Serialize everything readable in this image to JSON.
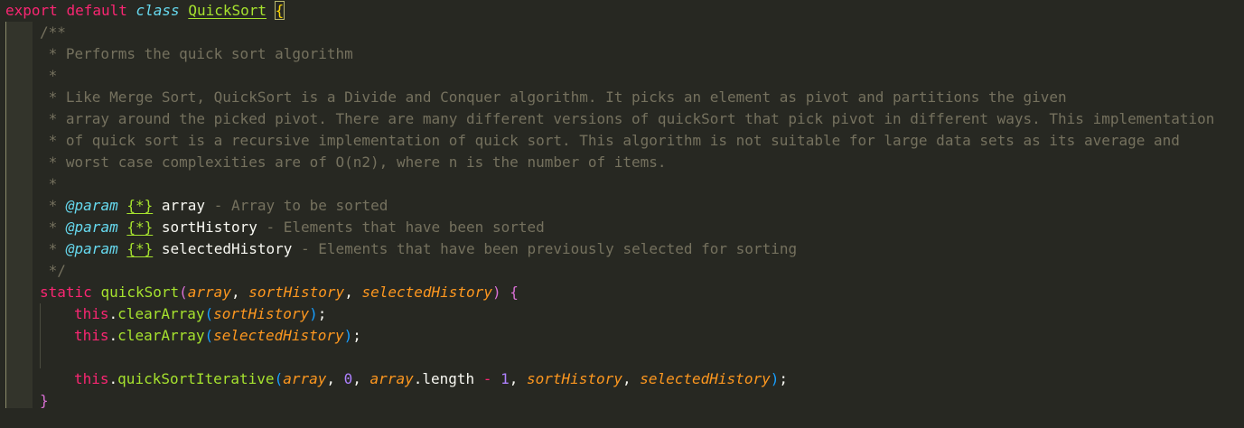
{
  "code": {
    "l1": {
      "export": "export",
      "default": "default",
      "class": "class",
      "name": "QuickSort",
      "brace": "{"
    },
    "l2": "/**",
    "l3": " * Performs the quick sort algorithm",
    "l4": " *",
    "l5": " * Like Merge Sort, QuickSort is a Divide and Conquer algorithm. It picks an element as pivot and partitions the given",
    "l6": " * array around the picked pivot. There are many different versions of quickSort that pick pivot in different ways. This implementation",
    "l7": " * of quick sort is a recursive implementation of quick sort. This algorithm is not suitable for large data sets as its average and",
    "l8": " * worst case complexities are of O(n2), where n is the number of items.",
    "l9": " *",
    "p1": {
      "star": " * ",
      "tag": "@param",
      "type": "{*}",
      "name": "array",
      "desc": " - Array to be sorted"
    },
    "p2": {
      "star": " * ",
      "tag": "@param",
      "type": "{*}",
      "name": "sortHistory",
      "desc": " - Elements that have been sorted"
    },
    "p3": {
      "star": " * ",
      "tag": "@param",
      "type": "{*}",
      "name": "selectedHistory",
      "desc": " - Elements that have been previously selected for sorting"
    },
    "l13": " */",
    "l14": {
      "static": "static",
      "fn": "quickSort",
      "open": "(",
      "a": "array",
      "c1": ", ",
      "b": "sortHistory",
      "c2": ", ",
      "c": "selectedHistory",
      "close": ")",
      "brace": " {"
    },
    "l15": {
      "this": "this",
      "dot": ".",
      "fn": "clearArray",
      "open": "(",
      "arg": "sortHistory",
      "close": ")",
      "semi": ";"
    },
    "l16": {
      "this": "this",
      "dot": ".",
      "fn": "clearArray",
      "open": "(",
      "arg": "selectedHistory",
      "close": ")",
      "semi": ";"
    },
    "l18": {
      "this": "this",
      "dot": ".",
      "fn": "quickSortIterative",
      "open": "(",
      "a": "array",
      "c1": ", ",
      "zero": "0",
      "c2": ", ",
      "arr2": "array",
      "dot2": ".",
      "len": "length",
      "sp1": " ",
      "minus": "-",
      "sp2": " ",
      "one": "1",
      "c3": ", ",
      "b": "sortHistory",
      "c4": ", ",
      "c": "selectedHistory",
      "close": ")",
      "semi": ";"
    },
    "l19": "}"
  }
}
